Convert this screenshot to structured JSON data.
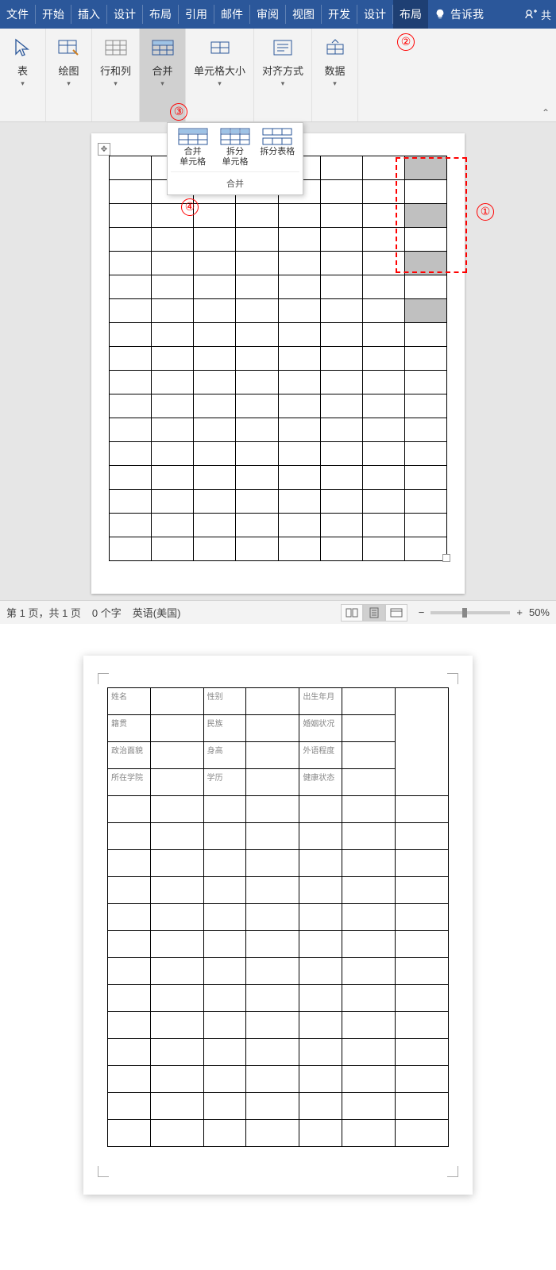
{
  "menubar": {
    "items": [
      "文件",
      "开始",
      "插入",
      "设计",
      "布局",
      "引用",
      "邮件",
      "审阅",
      "视图",
      "开发",
      "设计",
      "布局"
    ],
    "active_index": 11,
    "tell_me": "告诉我",
    "share_icon": "共享"
  },
  "ribbon": {
    "groups": [
      {
        "label": "表",
        "icon": "cursor"
      },
      {
        "label": "绘图",
        "icon": "draw"
      },
      {
        "label": "行和列",
        "icon": "grid"
      },
      {
        "label": "合并",
        "icon": "merge",
        "active": true
      },
      {
        "label": "单元格大小",
        "icon": "cellsize"
      },
      {
        "label": "对齐方式",
        "icon": "align"
      },
      {
        "label": "数据",
        "icon": "data"
      }
    ]
  },
  "dropdown": {
    "items": [
      {
        "label": "合并\n单元格"
      },
      {
        "label": "拆分\n单元格"
      },
      {
        "label": "拆分表格"
      }
    ],
    "title": "合并"
  },
  "annotations": {
    "a1": "①",
    "a2": "②",
    "a3": "③",
    "a4": "④"
  },
  "statusbar": {
    "page": "第 1 页，共 1 页",
    "words": "0 个字",
    "lang": "英语(美国)",
    "zoom": "50%"
  },
  "preview": {
    "fields": {
      "r1c1": "姓名",
      "r1c3": "性别",
      "r1c5": "出生年月",
      "r2c1": "籍贯",
      "r2c3": "民族",
      "r2c5": "婚姻状况",
      "r3c1": "政治面貌",
      "r3c3": "身高",
      "r3c5": "外语程度",
      "r4c1": "所在学院",
      "r4c3": "学历",
      "r4c5": "健康状态"
    }
  }
}
